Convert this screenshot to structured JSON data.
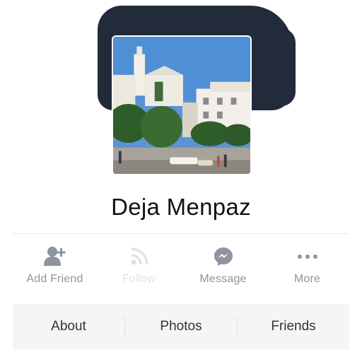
{
  "profile": {
    "name": "Deja Menpaz",
    "photo_icon": "town-photo"
  },
  "actions": [
    {
      "label": "Add Friend",
      "icon": "add-friend-icon",
      "enabled": true
    },
    {
      "label": "Follow",
      "icon": "rss-icon",
      "enabled": false
    },
    {
      "label": "Message",
      "icon": "messenger-icon",
      "enabled": true
    },
    {
      "label": "More",
      "icon": "more-icon",
      "enabled": true
    }
  ],
  "tabs": [
    "About",
    "Photos",
    "Friends"
  ],
  "colors": {
    "cover": "#222b3a",
    "icon_active": "#8d949e",
    "icon_disabled": "#dfe2e6",
    "tab_bg": "#f4f5f7"
  }
}
